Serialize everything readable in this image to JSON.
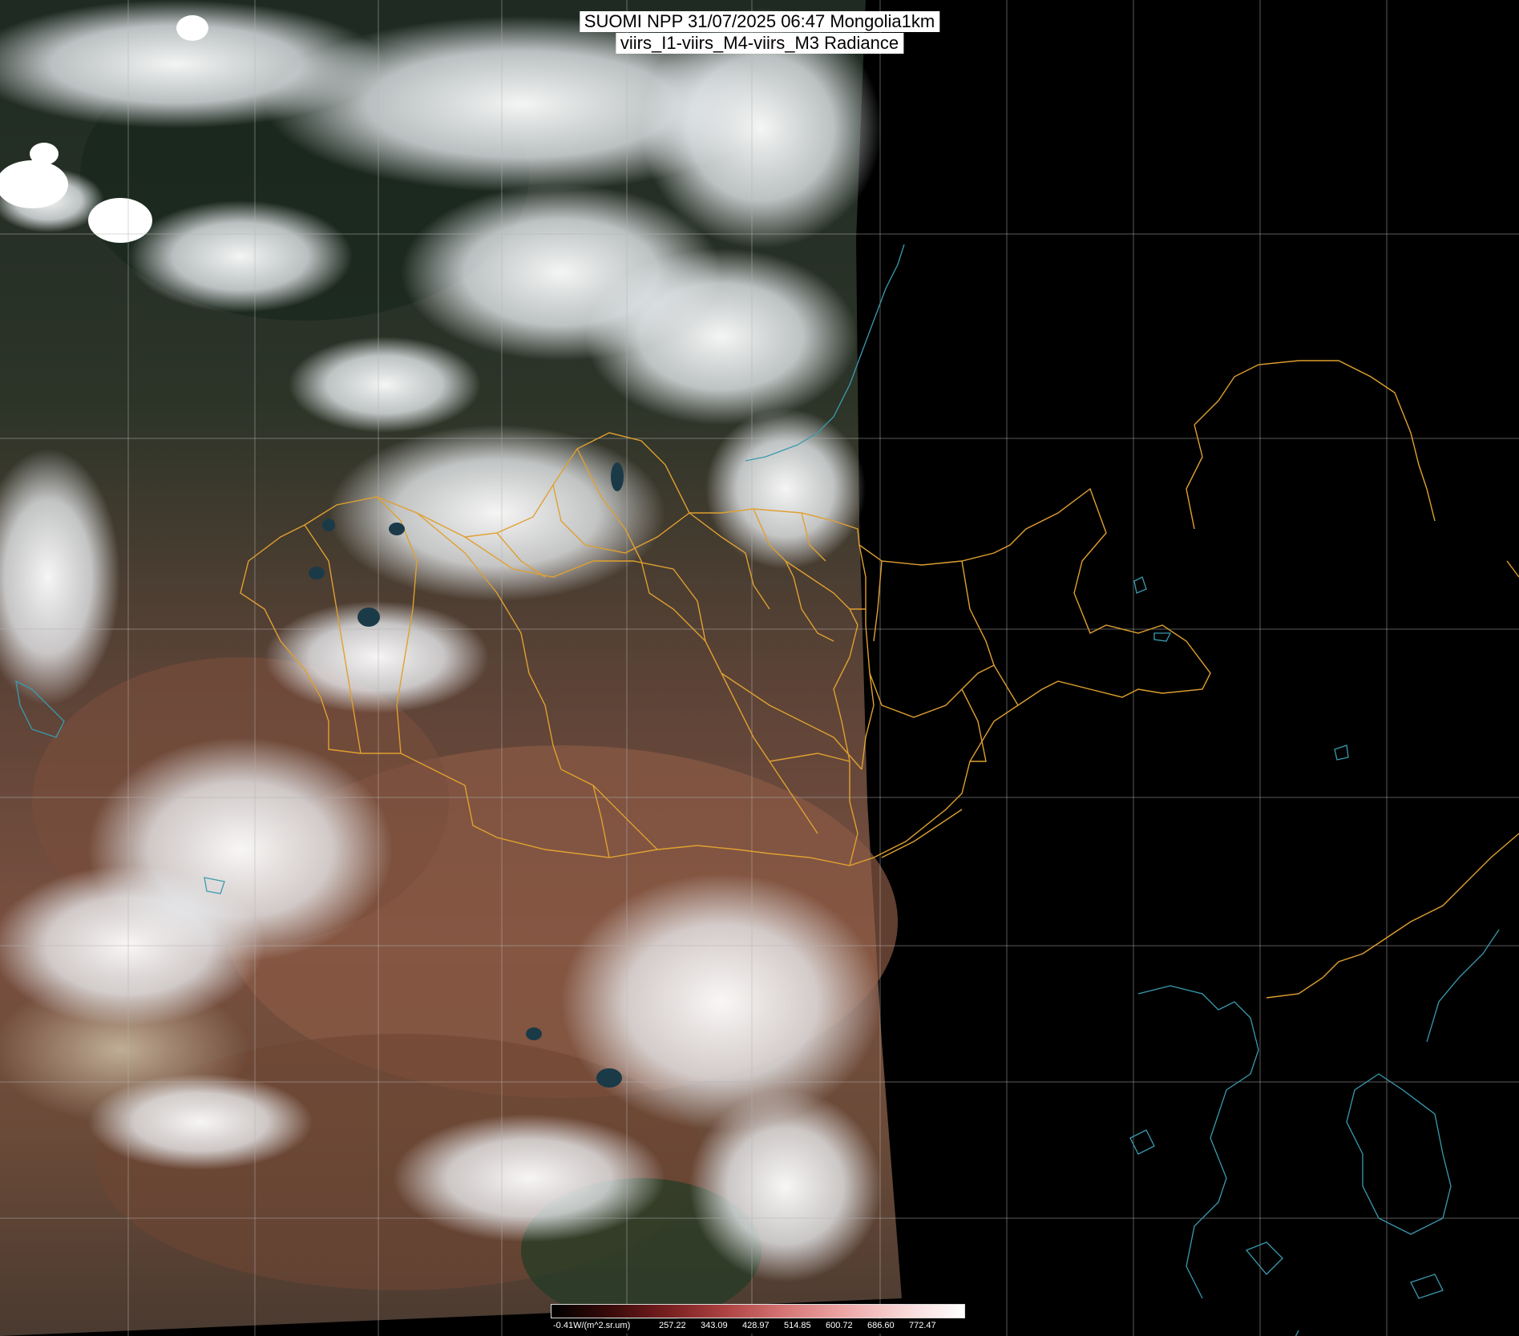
{
  "title": {
    "line1": "SUOMI NPP 31/07/2025 06:47 Mongolia1km",
    "line2": "viirs_I1-viirs_M4-viirs_M3 Radiance"
  },
  "legend": {
    "labels": [
      "-0.41W/(m^2.sr.um)",
      "257.22",
      "343.09",
      "428.97",
      "514.85",
      "600.72",
      "686.60",
      "772.47"
    ],
    "colors": [
      "#000000",
      "#3a0a0a",
      "#7a2020",
      "#b04545",
      "#d87878",
      "#eea8a8",
      "#f8d8d8",
      "#ffffff"
    ]
  },
  "colors": {
    "background": "#000000",
    "border": "#e0a030",
    "coast": "#3a9bb0",
    "grid": "#b4b4b4",
    "land_brown": "#7a5040",
    "land_dark": "#2a3a2a",
    "cloud": "#f0f4f8"
  }
}
